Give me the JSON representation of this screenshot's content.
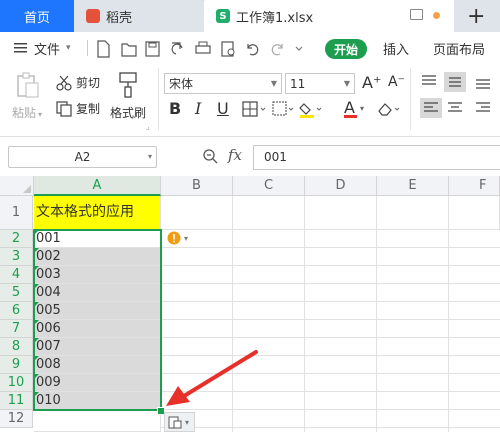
{
  "tabs": {
    "home": "首页",
    "docer": "稻壳",
    "workbook": "工作簿1.xlsx",
    "add": "+"
  },
  "menu": {
    "file": "文件",
    "start": "开始",
    "insert": "插入",
    "layout": "页面布局"
  },
  "ribbon": {
    "paste": "粘贴",
    "cut": "剪切",
    "copy": "复制",
    "format_painter": "格式刷",
    "font_name": "宋体",
    "font_size": "11",
    "bold": "B",
    "italic": "I",
    "underline": "U",
    "font_color": "A",
    "grow": "A⁺",
    "shrink": "A⁻"
  },
  "formula_bar": {
    "name_box": "A2",
    "fx": "fx",
    "content": "001"
  },
  "columns": [
    "A",
    "B",
    "C",
    "D",
    "E",
    "F"
  ],
  "rows": [
    "1",
    "2",
    "3",
    "4",
    "5",
    "6",
    "7",
    "8",
    "9",
    "10",
    "11",
    "12"
  ],
  "cells": {
    "a1": "文本格式的应用",
    "a_values": [
      "001",
      "002",
      "003",
      "004",
      "005",
      "006",
      "007",
      "008",
      "009",
      "010"
    ]
  },
  "colors": {
    "accent": "#1d9e4f",
    "home_tab": "#1e76ff",
    "header_fill": "#ffff00",
    "arrow": "#e8302a",
    "warning": "#f39c12"
  }
}
